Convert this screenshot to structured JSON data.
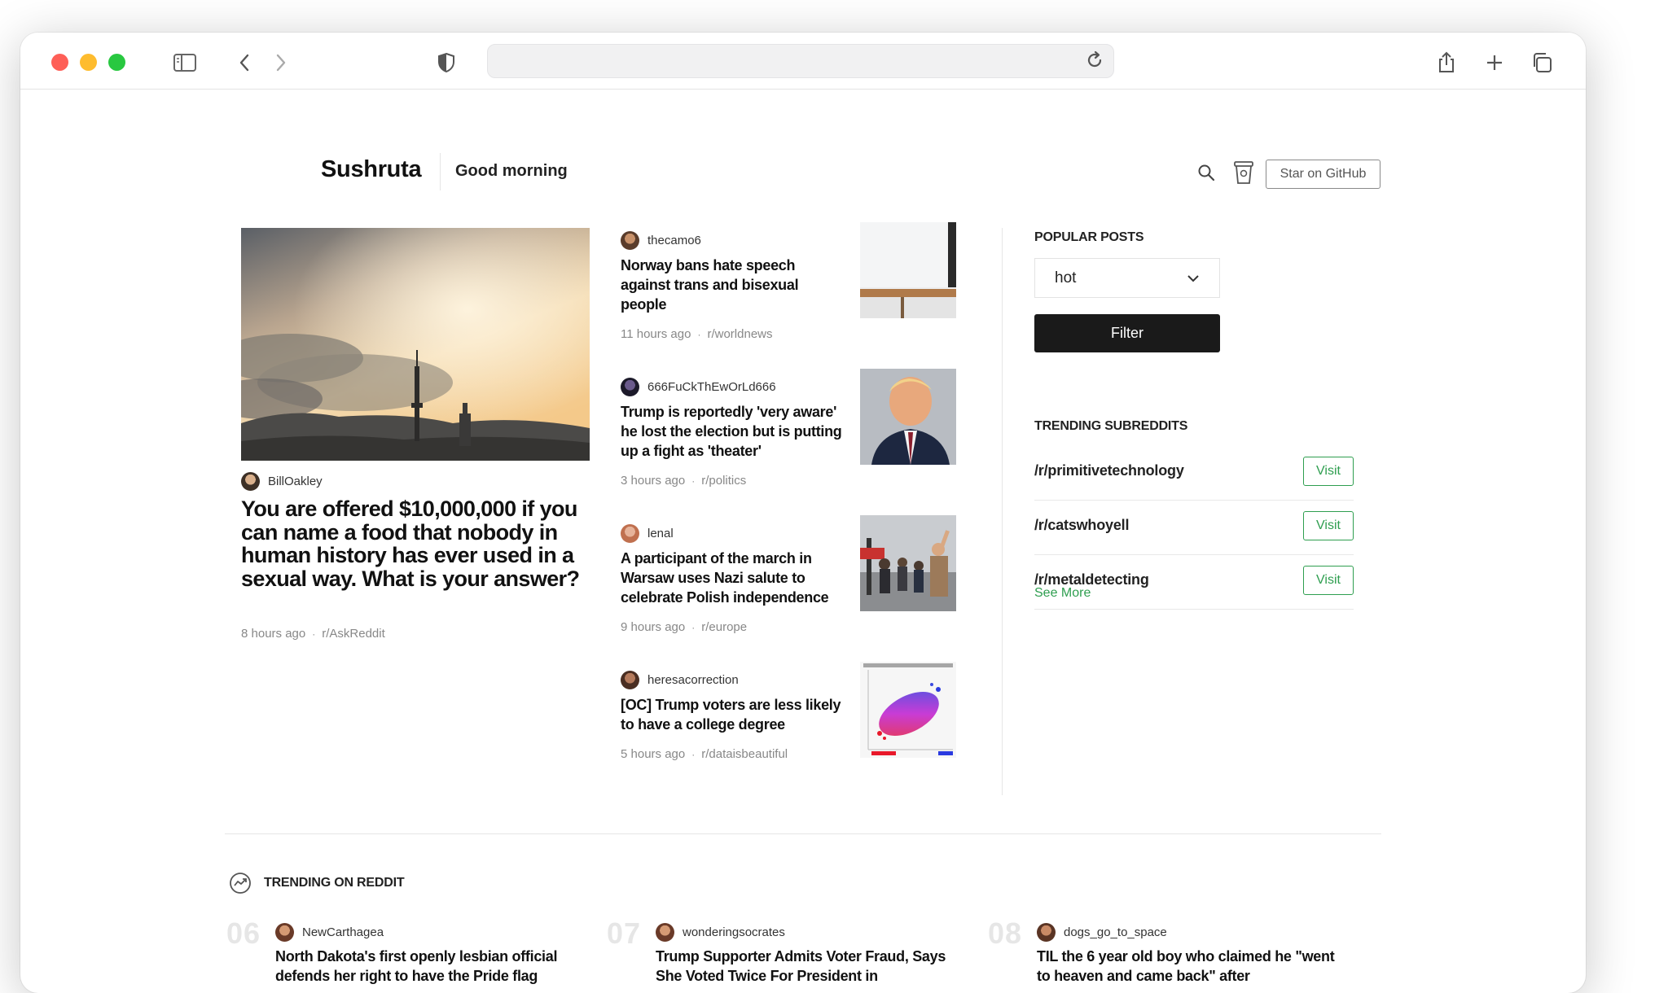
{
  "header": {
    "brand": "Sushruta",
    "greeting": "Good morning",
    "github_button": "Star on GitHub"
  },
  "featured": {
    "author": "BillOakley",
    "title": "You are offered $10,000,000 if you can name a food that nobody in human history has ever used in a sexual way. What is your answer?",
    "time": "8 hours ago",
    "subreddit": "r/AskReddit"
  },
  "posts": [
    {
      "author": "thecamo6",
      "title": "Norway bans hate speech against trans and bisexual people",
      "time": "11 hours ago",
      "subreddit": "r/worldnews"
    },
    {
      "author": "666FuCkThEwOrLd666",
      "title": "Trump is reportedly 'very aware' he lost the election but is putting up a fight as 'theater'",
      "time": "3 hours ago",
      "subreddit": "r/politics"
    },
    {
      "author": "lenal",
      "title": "A participant of the march in Warsaw uses Nazi salute to celebrate Polish independence",
      "time": "9 hours ago",
      "subreddit": "r/europe"
    },
    {
      "author": "heresacorrection",
      "title": "[OC] Trump voters are less likely to have a college degree",
      "time": "5 hours ago",
      "subreddit": "r/dataisbeautiful"
    }
  ],
  "sidebar": {
    "popular_heading": "POPULAR POSTS",
    "sort_value": "hot",
    "filter_label": "Filter",
    "trending_heading": "TRENDING SUBREDDITS",
    "subreddits": [
      {
        "name": "/r/primitivetechnology",
        "action": "Visit"
      },
      {
        "name": "/r/catswhoyell",
        "action": "Visit"
      },
      {
        "name": "/r/metaldetecting",
        "action": "Visit"
      }
    ],
    "see_more": "See More"
  },
  "trending": {
    "heading": "TRENDING ON REDDIT",
    "items": [
      {
        "num": "06",
        "author": "NewCarthagea",
        "title": "North Dakota's first openly lesbian official defends her right to have the Pride flag"
      },
      {
        "num": "07",
        "author": "wonderingsocrates",
        "title": "Trump Supporter Admits Voter Fraud, Says She Voted Twice For President in"
      },
      {
        "num": "08",
        "author": "dogs_go_to_space",
        "title": "TIL the 6 year old boy who claimed he \"went to heaven and came back\" after"
      }
    ]
  },
  "colors": {
    "accent_green": "#2e9e4f",
    "filter_button": "#1a1a1a"
  }
}
